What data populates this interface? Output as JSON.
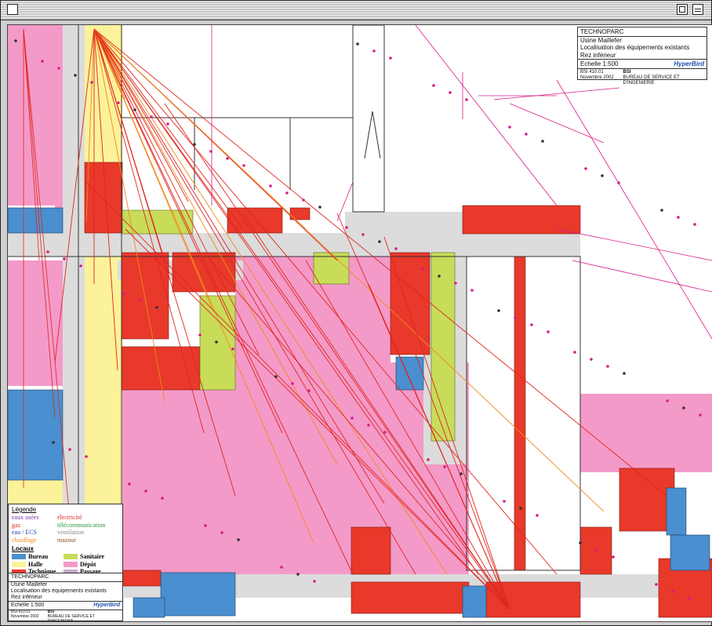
{
  "window": {
    "controls": {
      "close": "close-box",
      "zoom": "zoom-box",
      "collapse": "collapse-box"
    }
  },
  "title_block_top": {
    "project": "TECHNOPARC",
    "site": "Usine Maillefer",
    "subject": "Localisation des équipements existants",
    "level": "Rez inférieur",
    "scale": "Echelle 1:500",
    "logo": "HyperBird",
    "drawing_no": "BSI 410.01",
    "firm_abbr": "BSI",
    "firm": "BUREAU DE SERVICE ET D'INGENIERIE",
    "date": "Novembre 2002"
  },
  "title_block_bottom": {
    "project": "TECHNOPARC",
    "site": "Usine Maillefer",
    "subject": "Localisation des équipements existants",
    "level": "Rez inférieur",
    "scale": "Echelle 1:500",
    "logo": "HyperBird",
    "drawing_no": "BSI 410.01",
    "firm_abbr": "BSI",
    "firm": "BUREAU DE SERVICE ET D'INGENIERIE",
    "date": "Novembre 2002"
  },
  "legend": {
    "title": "Légende",
    "networks": [
      {
        "label": "eaux usées",
        "color": "#7b2fa8"
      },
      {
        "label": "gaz",
        "color": "#e0261f"
      },
      {
        "label": "eau / ECS",
        "color": "#1f3fb0"
      },
      {
        "label": "chauffage",
        "color": "#f08a1e"
      },
      {
        "label": "électricité",
        "color": "#e0261f"
      },
      {
        "label": "télécommunication",
        "color": "#2a9a3a"
      },
      {
        "label": "ventilation",
        "color": "#8a8a8a"
      },
      {
        "label": "mazout",
        "color": "#8a4b1e"
      }
    ],
    "rooms_title": "Locaux",
    "rooms": [
      {
        "label": "Bureau",
        "color": "#4a8fd0"
      },
      {
        "label": "Halle",
        "color": "#fbf29a"
      },
      {
        "label": "Technique",
        "color": "#e8392a"
      },
      {
        "label": "Sanitaire",
        "color": "#c8dc5a"
      },
      {
        "label": "Dépôt",
        "color": "#f49ac8"
      },
      {
        "label": "Passage",
        "color": "#c8a8c8"
      }
    ]
  },
  "colors": {
    "bureau": "#4a8fd0",
    "halle": "#fbf29a",
    "technique": "#e8392a",
    "sanitaire": "#c8dc5a",
    "depot": "#f49ac8",
    "passage": "#dcdcdc",
    "line_red": "#e0261f",
    "line_magenta": "#d81b8a",
    "line_orange": "#f08a1e"
  }
}
